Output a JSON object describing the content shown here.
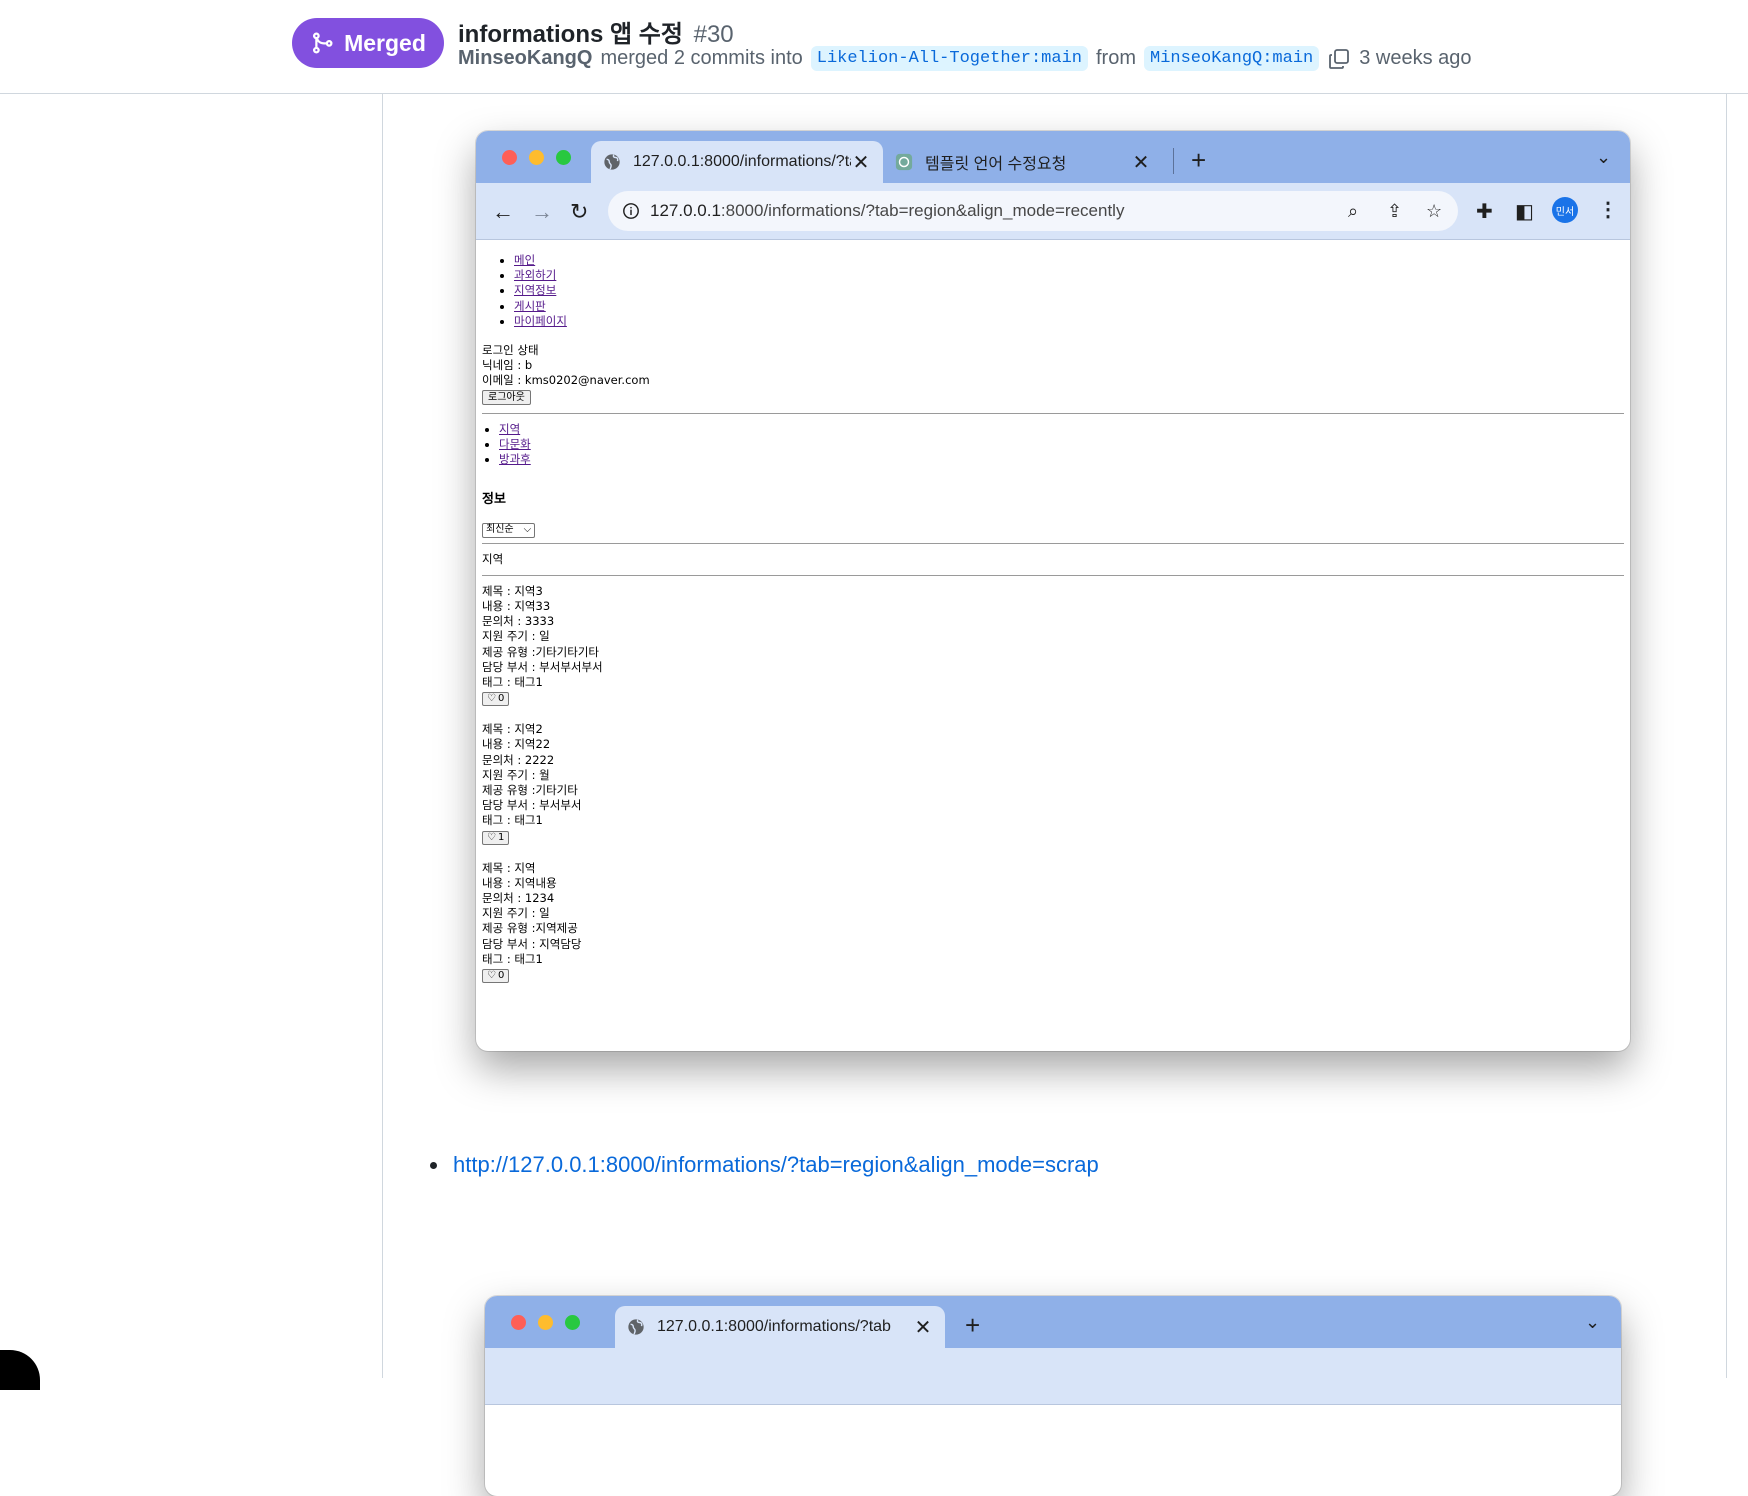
{
  "pr": {
    "status": "Merged",
    "title": "informations 앱 수정",
    "number": "#30",
    "author": "MinseoKangQ",
    "merged_text": "merged 2 commits into",
    "base_branch": "Likelion-All-Together:main",
    "from_text": "from",
    "head_branch": "MinseoKangQ:main",
    "time_ago": "3 weeks ago",
    "accent_color": "#8250df"
  },
  "browser1": {
    "tabs": [
      {
        "title": "127.0.0.1:8000/informations/?tab",
        "active": true
      },
      {
        "title": "템플릿 언어 수정요청",
        "active": false
      }
    ],
    "url_host": "127.0.0.1",
    "url_rest": ":8000/informations/?tab=region&align_mode=recently",
    "profile": "민서",
    "page": {
      "nav": [
        "메인",
        "과외하기",
        "지역정보",
        "게시판",
        "마이페이지"
      ],
      "login_status": "로그인 상태",
      "nickname": "닉네임 : b",
      "email": "이메일 : kms0202@naver.com",
      "logout_label": "로그아웃",
      "subnav": [
        "지역",
        "다문화",
        "방과후"
      ],
      "heading": "정보",
      "sort_selected": "최신순",
      "section_label": "지역",
      "items": [
        {
          "title": "제목 : 지역3",
          "content": "내용 : 지역33",
          "contact": "문의처 : 3333",
          "cycle": "지원 주기 : 일",
          "type": "제공 유형 :기타기타기타",
          "dept": "담당 부서 : 부서부서부서",
          "tag": "태그 : 태그1",
          "likes": "0"
        },
        {
          "title": "제목 : 지역2",
          "content": "내용 : 지역22",
          "contact": "문의처 : 2222",
          "cycle": "지원 주기 : 월",
          "type": "제공 유형 :기타기타",
          "dept": "담당 부서 : 부서부서",
          "tag": "태그 : 태그1",
          "likes": "1"
        },
        {
          "title": "제목 : 지역",
          "content": "내용 : 지역내용",
          "contact": "문의처 : 1234",
          "cycle": "지원 주기 : 일",
          "type": "제공 유형 :지역제공",
          "dept": "담당 부서 : 지역담당",
          "tag": "태그 : 태그1",
          "likes": "0"
        }
      ]
    }
  },
  "link": {
    "url": "http://127.0.0.1:8000/informations/?tab=region&align_mode=scrap"
  },
  "browser2": {
    "tabs": [
      {
        "title": "127.0.0.1:8000/informations/?tab",
        "active": true
      }
    ]
  }
}
